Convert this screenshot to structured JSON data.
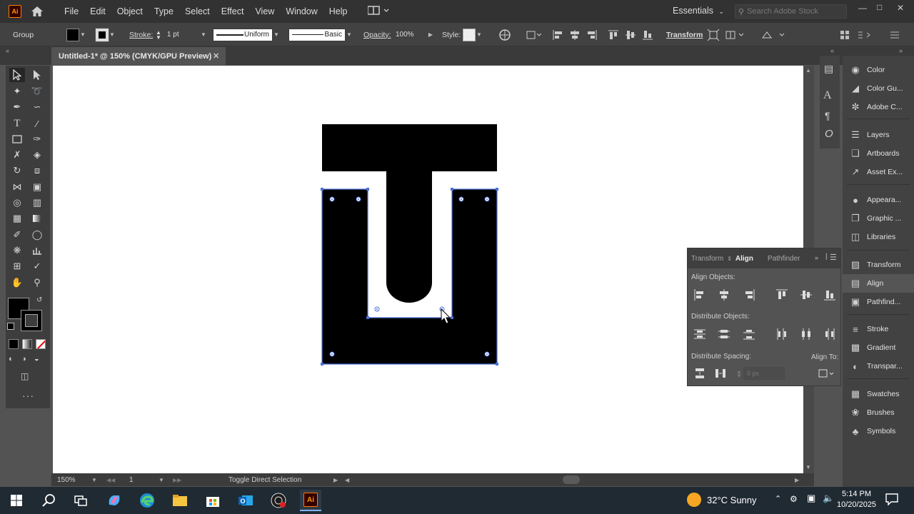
{
  "app": {
    "logo": "Ai"
  },
  "menu": [
    "File",
    "Edit",
    "Object",
    "Type",
    "Select",
    "Effect",
    "View",
    "Window",
    "Help"
  ],
  "workspace": "Essentials",
  "search": {
    "placeholder": "Search Adobe Stock"
  },
  "control": {
    "selection": "Group",
    "stroke_label": "Stroke:",
    "stroke_weight": "1 pt",
    "stroke_profile": "Uniform",
    "brush": "Basic",
    "opacity_label": "Opacity:",
    "opacity": "100%",
    "style_label": "Style:",
    "transform_label": "Transform"
  },
  "document": {
    "tab_title": "Untitled-1* @ 150% (CMYK/GPU Preview)"
  },
  "status": {
    "zoom": "150%",
    "artboard": "1",
    "hint": "Toggle Direct Selection"
  },
  "dock": [
    {
      "label": "Color",
      "icon": "color-icon"
    },
    {
      "label": "Color Gu...",
      "icon": "color-guide-icon"
    },
    {
      "label": "Adobe C...",
      "icon": "adobe-color-icon"
    },
    {
      "label": "Layers",
      "icon": "layers-icon"
    },
    {
      "label": "Artboards",
      "icon": "artboards-icon"
    },
    {
      "label": "Asset Ex...",
      "icon": "asset-export-icon"
    },
    {
      "label": "Appeara...",
      "icon": "appearance-icon"
    },
    {
      "label": "Graphic ...",
      "icon": "graphic-styles-icon"
    },
    {
      "label": "Libraries",
      "icon": "libraries-icon"
    },
    {
      "label": "Transform",
      "icon": "transform-icon"
    },
    {
      "label": "Align",
      "icon": "align-icon"
    },
    {
      "label": "Pathfind...",
      "icon": "pathfinder-icon"
    },
    {
      "label": "Stroke",
      "icon": "stroke-icon"
    },
    {
      "label": "Gradient",
      "icon": "gradient-icon"
    },
    {
      "label": "Transpar...",
      "icon": "transparency-icon"
    },
    {
      "label": "Swatches",
      "icon": "swatches-icon"
    },
    {
      "label": "Brushes",
      "icon": "brushes-icon"
    },
    {
      "label": "Symbols",
      "icon": "symbols-icon"
    }
  ],
  "align_panel": {
    "tabs": [
      "Transform",
      "Align",
      "Pathfinder"
    ],
    "align_objects": "Align Objects:",
    "distribute_objects": "Distribute Objects:",
    "distribute_spacing": "Distribute Spacing:",
    "align_to": "Align To:",
    "spacing_value": "0 px"
  },
  "taskbar": {
    "weather": "32°C  Sunny",
    "time": "5:14 PM",
    "date": "10/20/2025"
  },
  "colors": {
    "accent": "#4a6fd8",
    "canvas": "#ffffff",
    "artwork": "#000000",
    "ui_dark": "#323232",
    "ui_mid": "#535353"
  }
}
